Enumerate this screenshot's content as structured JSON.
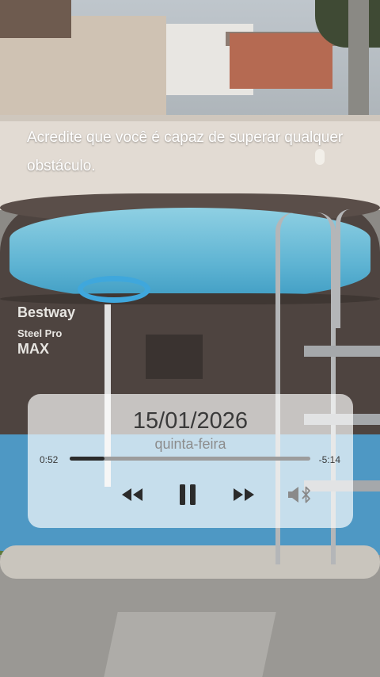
{
  "overlay": {
    "motivation_text": "Acredite que você é capaz de superar qualquer obstáculo."
  },
  "photo": {
    "pool_brand": "Bestway",
    "pool_model_line1": "Steel Pro",
    "pool_model_line2": "MAX"
  },
  "player": {
    "date": "15/01/2026",
    "weekday": "quinta-feira",
    "elapsed": "0:52",
    "remaining": "-5:14",
    "progress_fraction": 0.144,
    "controls": {
      "rewind": "rewind-icon",
      "pause": "pause-icon",
      "forward": "fast-forward-icon",
      "audio_output": "speaker-bluetooth-icon"
    },
    "colors": {
      "icon": "#2b2b2b",
      "track": "#9c9c9c",
      "track_fill": "#2b2b2b"
    }
  }
}
